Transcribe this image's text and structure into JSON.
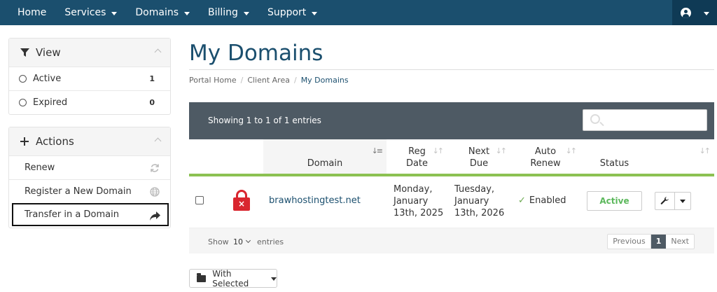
{
  "nav": {
    "items": [
      {
        "label": "Home",
        "dropdown": false
      },
      {
        "label": "Services",
        "dropdown": true
      },
      {
        "label": "Domains",
        "dropdown": true
      },
      {
        "label": "Billing",
        "dropdown": true
      },
      {
        "label": "Support",
        "dropdown": true
      }
    ],
    "account_icon": "user-circle-icon"
  },
  "sidebar": {
    "view": {
      "title": "View",
      "items": [
        {
          "label": "Active",
          "count": "1"
        },
        {
          "label": "Expired",
          "count": "0"
        }
      ]
    },
    "actions": {
      "title": "Actions",
      "items": [
        {
          "label": "Renew",
          "icon": "refresh-icon"
        },
        {
          "label": "Register a New Domain",
          "icon": "globe-icon"
        },
        {
          "label": "Transfer in a Domain",
          "icon": "share-arrow-icon"
        }
      ]
    }
  },
  "page": {
    "title": "My Domains",
    "breadcrumb": [
      "Portal Home",
      "Client Area",
      "My Domains"
    ]
  },
  "table": {
    "showing": "Showing 1 to 1 of 1 entries",
    "columns": {
      "domain": "Domain",
      "reg_date_1": "Reg",
      "reg_date_2": "Date",
      "next_due_1": "Next",
      "next_due_2": "Due",
      "auto_renew_1": "Auto",
      "auto_renew_2": "Renew",
      "status": "Status"
    },
    "rows": [
      {
        "domain": "brawhostingtest.net",
        "reg_date": [
          "Monday,",
          "January",
          "13th, 2025"
        ],
        "next_due": [
          "Tuesday,",
          "January",
          "13th, 2026"
        ],
        "auto_renew": "Enabled",
        "status": "Active",
        "lock_badge": "×"
      }
    ],
    "footer": {
      "show": "Show",
      "length": "10",
      "entries": "entries",
      "previous": "Previous",
      "page": "1",
      "next": "Next"
    }
  },
  "bulk": {
    "label": "With Selected"
  },
  "colors": {
    "nav_bg": "#1b4f6e",
    "accent_green": "#8cc152",
    "header_bar": "#4e5a64",
    "status_active": "#5cb85c",
    "lock_red": "#d9262f"
  }
}
